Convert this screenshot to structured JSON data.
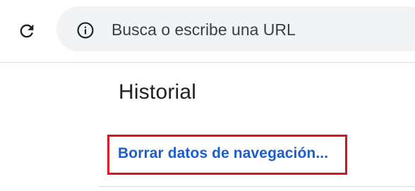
{
  "toolbar": {
    "reload_icon": "reload-icon",
    "omnibox": {
      "info_icon": "info-icon",
      "placeholder": "Busca o escribe una URL",
      "value": ""
    }
  },
  "history": {
    "title": "Historial",
    "clear_browsing_data_label": "Borrar datos de navegación..."
  },
  "colors": {
    "link": "#1a5fd0",
    "highlight": "#e0111c",
    "omnibox_bg": "#f1f3f4",
    "divider": "#dadce0"
  }
}
